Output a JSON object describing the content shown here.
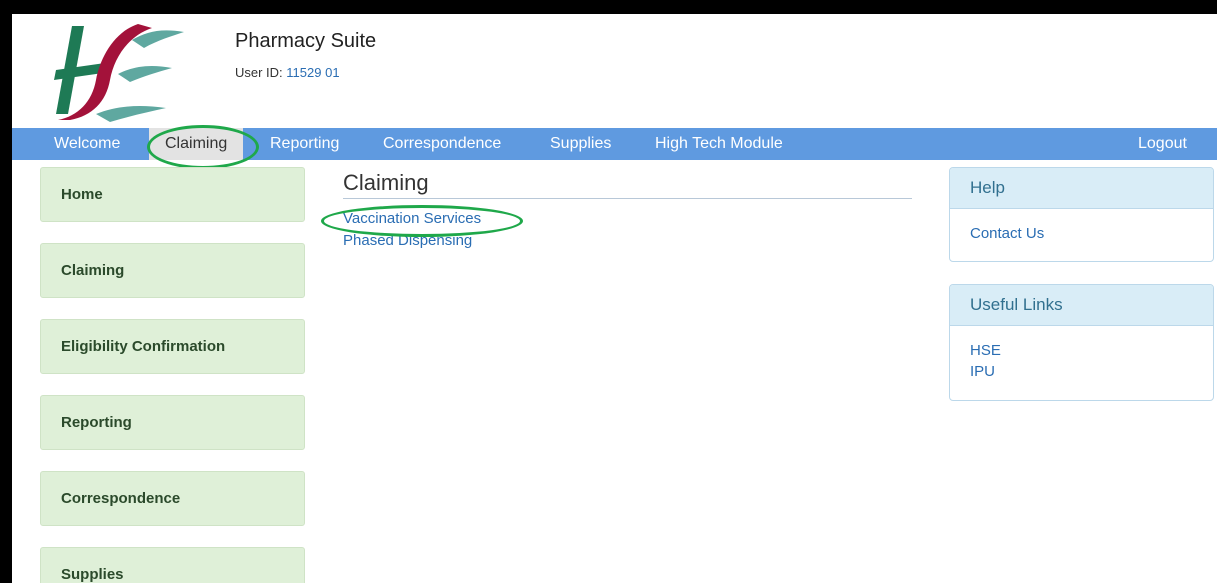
{
  "header": {
    "app_title": "Pharmacy Suite",
    "user_id_label": "User ID:",
    "user_id_value": "11529 01"
  },
  "nav": {
    "welcome": "Welcome",
    "claiming": "Claiming",
    "reporting": "Reporting",
    "correspondence": "Correspondence",
    "supplies": "Supplies",
    "high_tech": "High Tech Module",
    "logout": "Logout"
  },
  "sidebar": {
    "items": [
      {
        "label": "Home"
      },
      {
        "label": "Claiming"
      },
      {
        "label": "Eligibility Confirmation"
      },
      {
        "label": "Reporting"
      },
      {
        "label": "Correspondence"
      },
      {
        "label": "Supplies"
      }
    ]
  },
  "main": {
    "title": "Claiming",
    "links": [
      {
        "label": "Vaccination Services"
      },
      {
        "label": "Phased Dispensing"
      }
    ]
  },
  "help_panel": {
    "title": "Help",
    "links": [
      {
        "label": "Contact Us"
      }
    ]
  },
  "useful_links_panel": {
    "title": "Useful Links",
    "links": [
      {
        "label": "HSE"
      },
      {
        "label": "IPU"
      }
    ]
  },
  "colors": {
    "navbar": "#5f9ae0",
    "sidebar_button": "#dff0d8",
    "panel_header": "#d9edf7",
    "link": "#2a6db3",
    "annotation": "#1fa84a",
    "logo_green": "#1e7a55",
    "logo_red": "#a3123a",
    "logo_teal": "#5fa8a0"
  }
}
